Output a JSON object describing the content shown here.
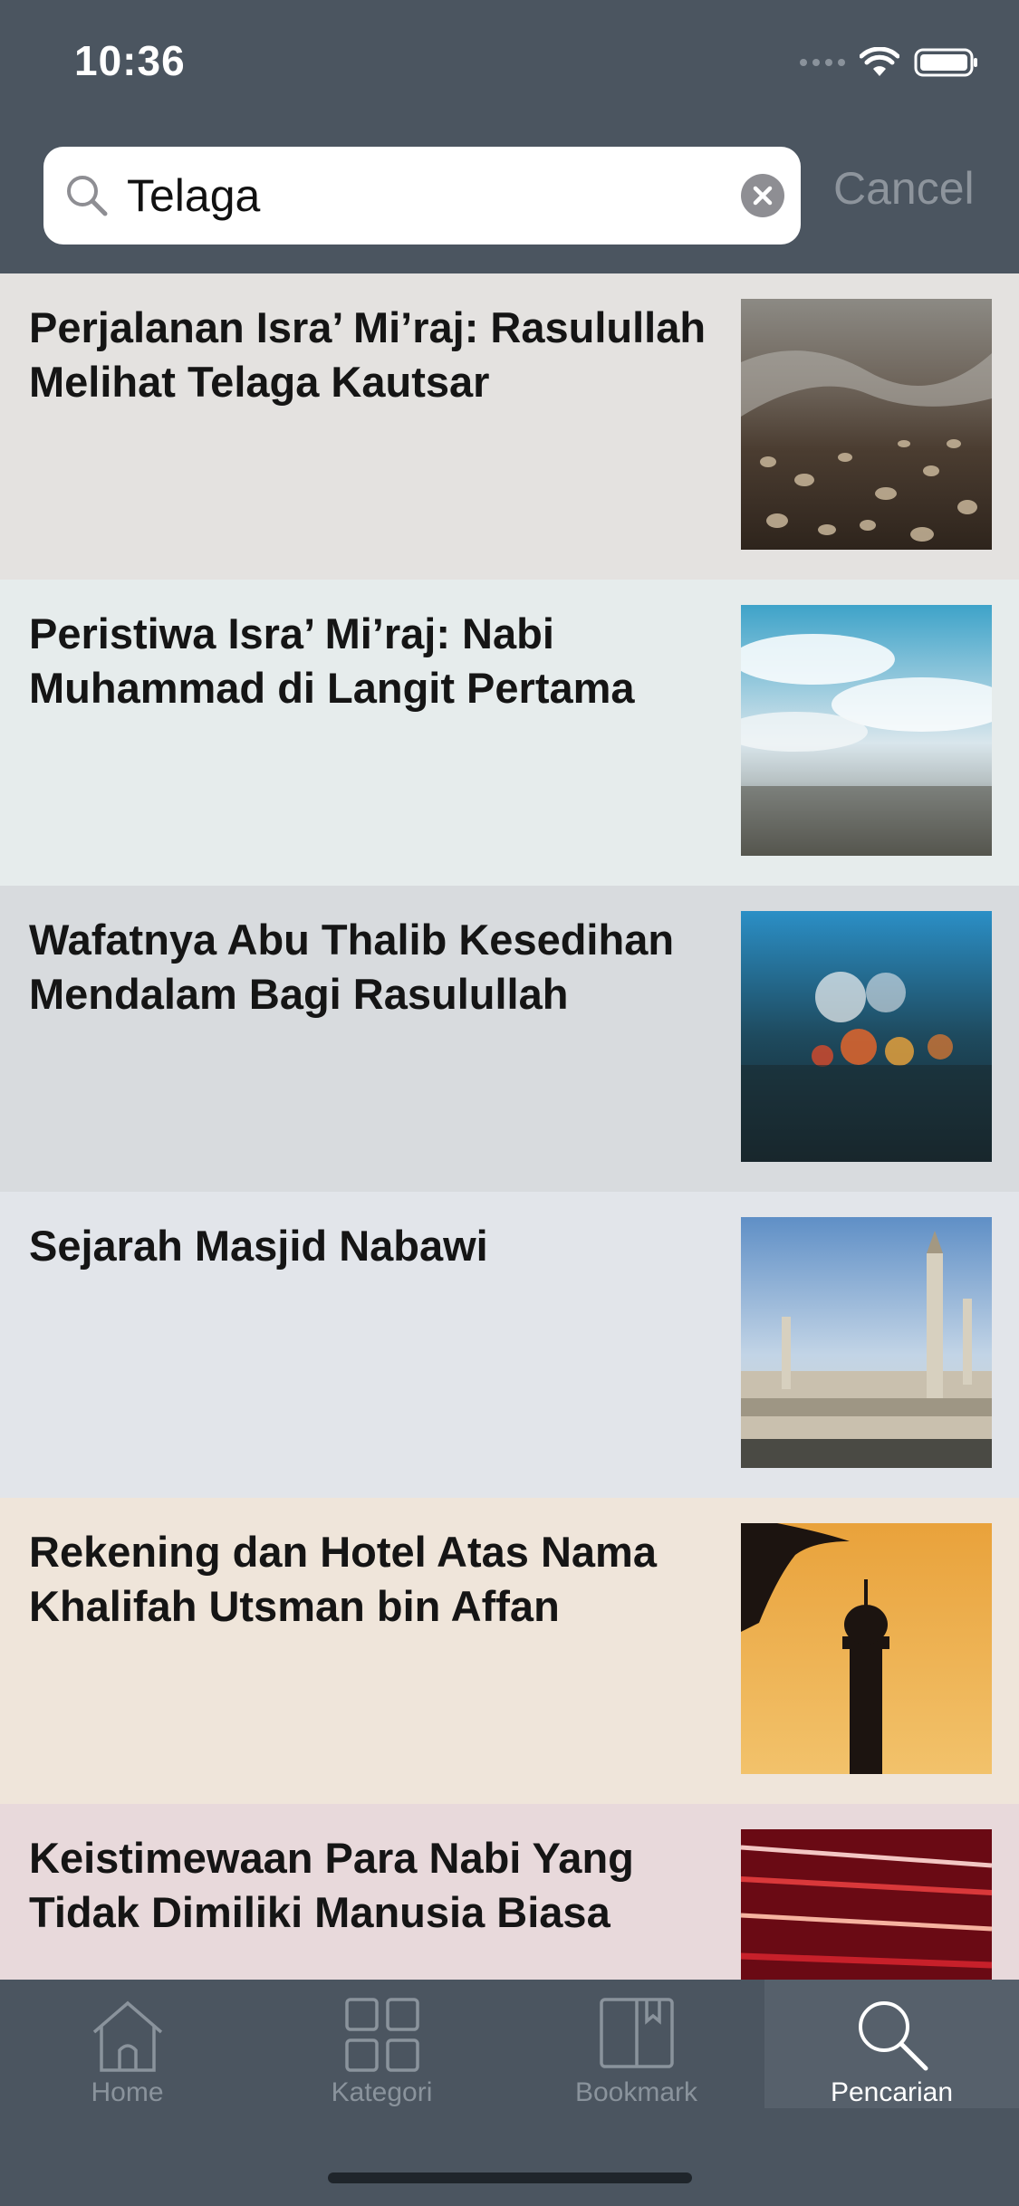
{
  "status_bar": {
    "time": "10:36"
  },
  "search": {
    "query": "Telaga",
    "cancel_label": "Cancel"
  },
  "results": [
    {
      "title": "Perjalanan Isra’ Mi’raj: Rasulullah Melihat Telaga Kautsar",
      "background": "#e4e2e0",
      "thumbnail": "pebble-shore-photo"
    },
    {
      "title": "Peristiwa Isra’ Mi’raj: Nabi Muhammad di Langit Pertama",
      "background": "#e6ecec",
      "thumbnail": "sky-clouds-photo"
    },
    {
      "title": "Wafatnya Abu Thalib Kesedihan Mendalam Bagi Rasulullah",
      "background": "#d8dbde",
      "thumbnail": "rainy-window-photo"
    },
    {
      "title": "Sejarah Masjid Nabawi",
      "background": "#e2e5ea",
      "thumbnail": "masjid-nabawi-photo"
    },
    {
      "title": "Rekening dan Hotel Atas Nama Khalifah Utsman bin Affan",
      "background": "#efe5da",
      "thumbnail": "minaret-sunset-photo"
    },
    {
      "title": "Keistimewaan Para Nabi Yang Tidak Dimiliki Manusia Biasa",
      "background": "#e8d9db",
      "thumbnail": "red-light-streaks-photo"
    }
  ],
  "tab_bar": {
    "tabs": [
      {
        "label": "Home",
        "icon": "home-icon",
        "active": false
      },
      {
        "label": "Kategori",
        "icon": "grid-icon",
        "active": false
      },
      {
        "label": "Bookmark",
        "icon": "book-icon",
        "active": false
      },
      {
        "label": "Pencarian",
        "icon": "search-icon",
        "active": true
      }
    ]
  },
  "colors": {
    "header_bg": "#4b5560",
    "active_tab_bg": "#56606b",
    "inactive_tab_text": "#8a939c"
  }
}
